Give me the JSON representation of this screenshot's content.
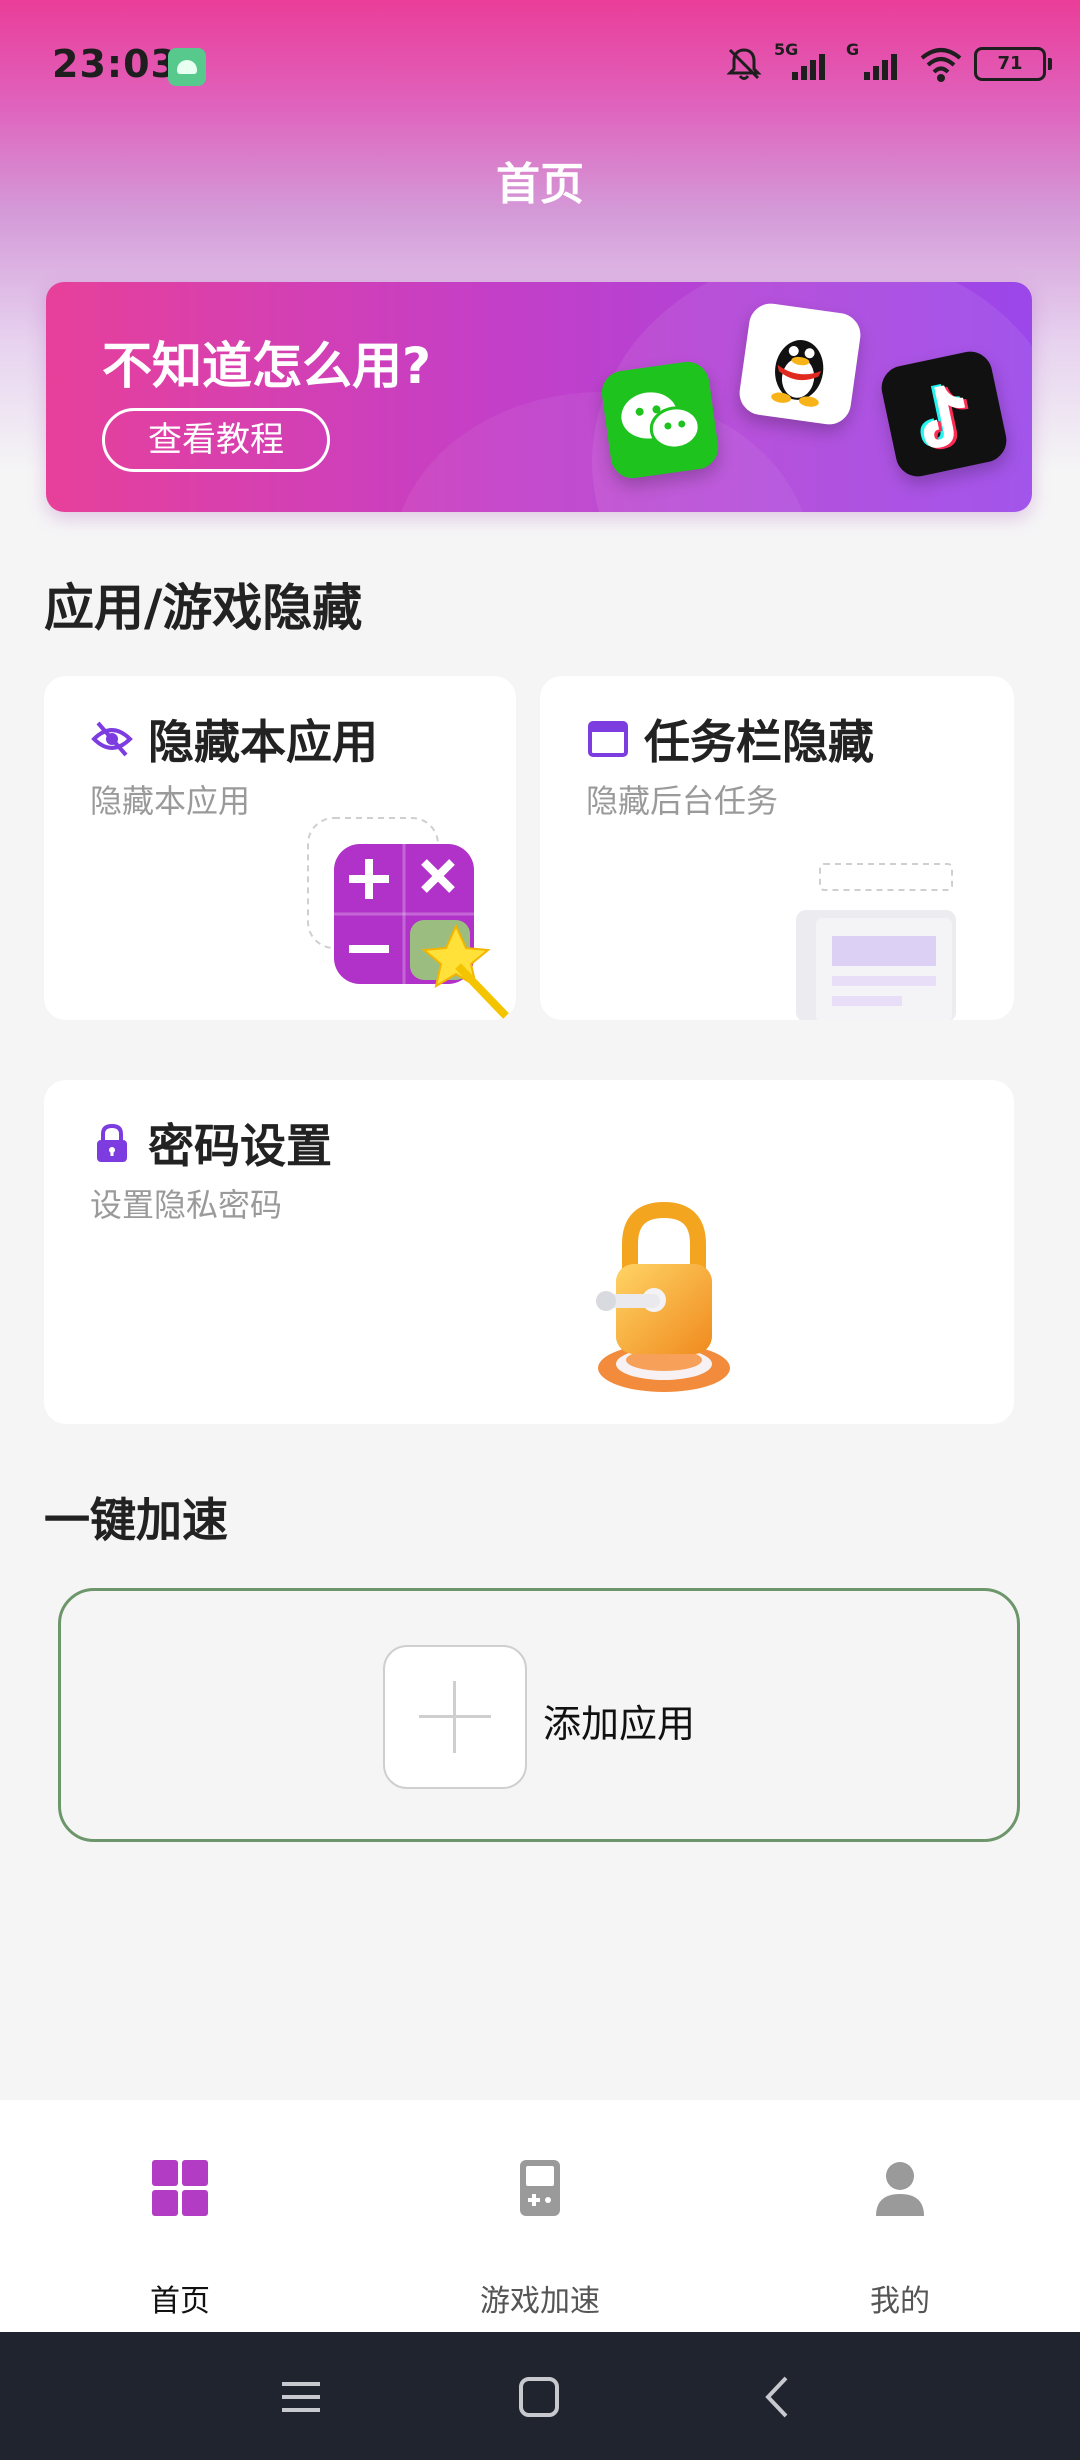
{
  "status_bar": {
    "time": "23:03",
    "sim1_label": "5G",
    "sim2_label": "G",
    "battery": "71",
    "icons": [
      "android-notification-icon",
      "bell-off-icon",
      "signal-icon",
      "wifi-icon",
      "battery-icon"
    ]
  },
  "header": {
    "title": "首页"
  },
  "banner": {
    "text": "不知道怎么用?",
    "button": "查看教程",
    "app_icons": [
      "wechat-icon",
      "qq-icon",
      "tiktok-icon"
    ]
  },
  "section_hide": {
    "title": "应用/游戏隐藏"
  },
  "cards": {
    "hide_app": {
      "title": "隐藏本应用",
      "subtitle": "隐藏本应用",
      "icon": "eye-off-icon"
    },
    "taskbar": {
      "title": "任务栏隐藏",
      "subtitle": "隐藏后台任务",
      "icon": "window-icon"
    },
    "password": {
      "title": "密码设置",
      "subtitle": "设置隐私密码",
      "icon": "lock-icon"
    }
  },
  "section_accel": {
    "title": "一键加速"
  },
  "accelerate": {
    "add_label": "添加应用"
  },
  "bottom_nav": {
    "items": [
      {
        "label": "首页",
        "icon": "grid-icon",
        "active": true
      },
      {
        "label": "游戏加速",
        "icon": "gameboy-icon",
        "active": false
      },
      {
        "label": "我的",
        "icon": "person-icon",
        "active": false
      }
    ],
    "active_color": "#b33cc4",
    "inactive_color": "#9a9a9a"
  },
  "colors": {
    "accent": "#7c3ce0",
    "brand_pink": "#ea3d99"
  }
}
